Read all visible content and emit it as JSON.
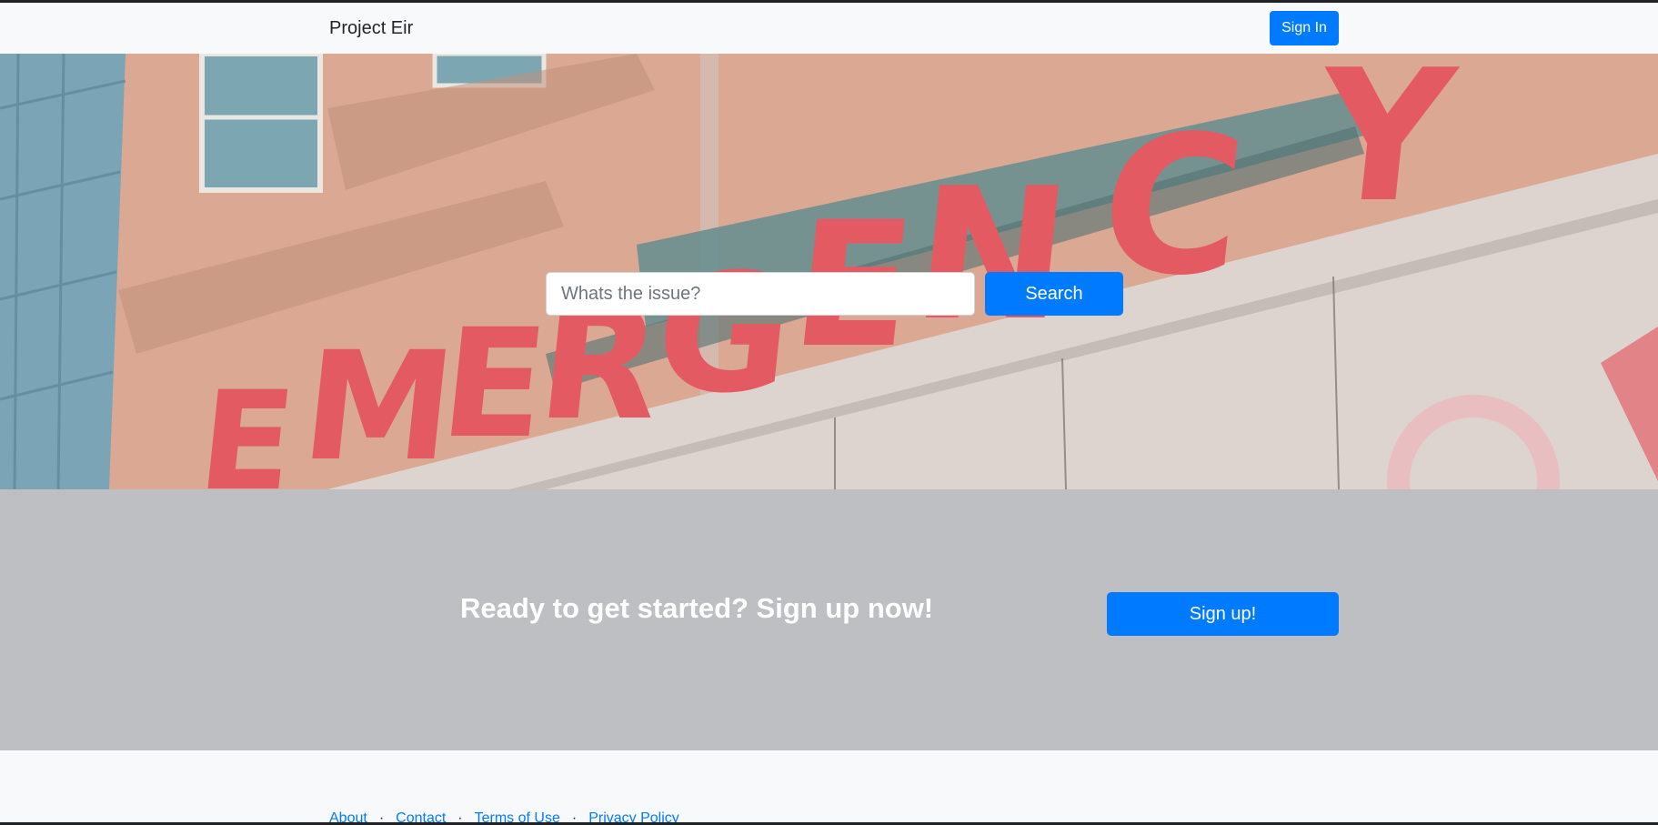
{
  "navbar": {
    "brand": "Project Eir",
    "signin_label": "Sign In"
  },
  "hero": {
    "search_placeholder": "Whats the issue?",
    "search_label": "Search",
    "background_image": "emergency-sign-photo"
  },
  "cta": {
    "heading": "Ready to get started? Sign up now!",
    "signup_label": "Sign up!"
  },
  "footer": {
    "links": [
      "About",
      "Contact",
      "Terms of Use",
      "Privacy Policy"
    ],
    "separator": "·"
  },
  "colors": {
    "primary": "#007bff",
    "navbar_bg": "#f8f9fa",
    "cta_bg": "#bdbfc2",
    "sign_red": "#e0444e"
  }
}
